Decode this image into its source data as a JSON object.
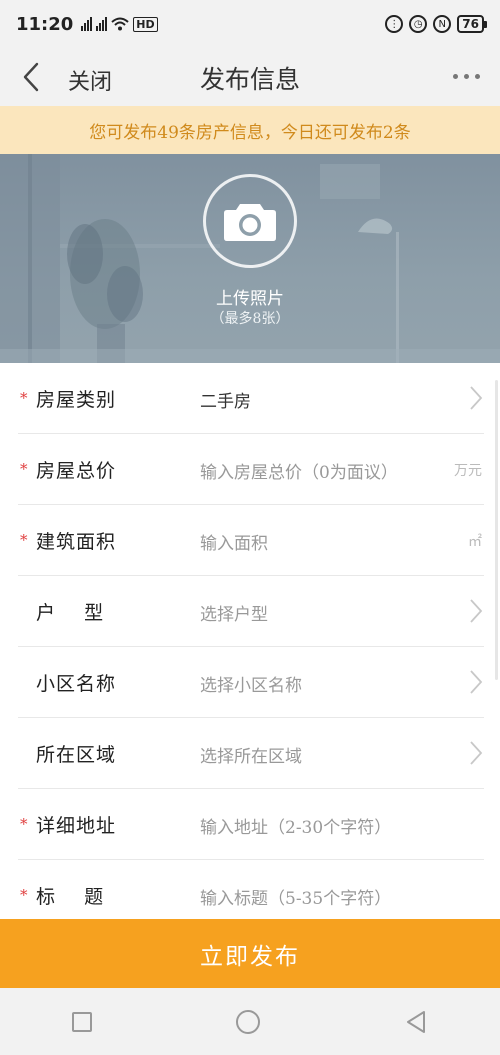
{
  "status_bar": {
    "time": "11:20",
    "network": "HD",
    "battery": "76"
  },
  "header": {
    "close_label": "关闭",
    "title": "发布信息"
  },
  "notice": {
    "text": "您可发布49条房产信息，今日还可发布2条"
  },
  "photo": {
    "upload_label": "上传照片",
    "limit_text": "（最多8张）"
  },
  "form": {
    "rows": [
      {
        "label": "房屋类别",
        "value": "二手房",
        "required": true,
        "unit": ""
      },
      {
        "label": "房屋总价",
        "placeholder": "输入房屋总价（0为面议）",
        "required": true,
        "unit": "万元"
      },
      {
        "label": "建筑面积",
        "placeholder": "输入面积",
        "required": true,
        "unit": "㎡"
      },
      {
        "label": "户    型",
        "placeholder": "选择户型",
        "required": false,
        "unit": ""
      },
      {
        "label": "小区名称",
        "placeholder": "选择小区名称",
        "required": false,
        "unit": ""
      },
      {
        "label": "所在区域",
        "placeholder": "选择所在区域",
        "required": false,
        "unit": ""
      },
      {
        "label": "详细地址",
        "placeholder": "输入地址（2-30个字符）",
        "required": true,
        "unit": ""
      },
      {
        "label": "标    题",
        "placeholder": "输入标题（5-35个字符）",
        "required": true,
        "unit": ""
      }
    ],
    "required_mark": "*"
  },
  "publish_button": "立即发布",
  "colors": {
    "accent": "#f6a11f",
    "notice_bg": "#fbe6bd",
    "notice_text": "#d08a1c",
    "required": "#e04040"
  },
  "icons": [
    "back-icon",
    "more-icon",
    "camera-icon",
    "chevron-right-icon"
  ]
}
